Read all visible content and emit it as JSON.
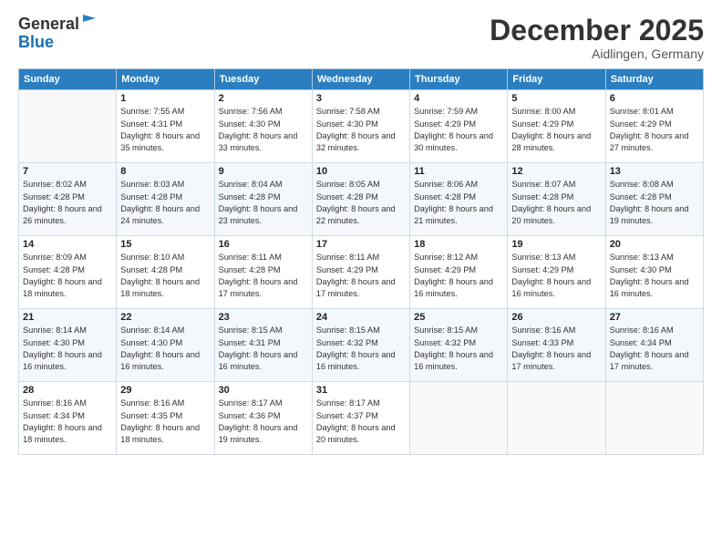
{
  "header": {
    "logo_line1": "General",
    "logo_line2": "Blue",
    "month": "December 2025",
    "location": "Aidlingen, Germany"
  },
  "weekdays": [
    "Sunday",
    "Monday",
    "Tuesday",
    "Wednesday",
    "Thursday",
    "Friday",
    "Saturday"
  ],
  "weeks": [
    [
      {
        "day": "",
        "sunrise": "",
        "sunset": "",
        "daylight": ""
      },
      {
        "day": "1",
        "sunrise": "Sunrise: 7:55 AM",
        "sunset": "Sunset: 4:31 PM",
        "daylight": "Daylight: 8 hours and 35 minutes."
      },
      {
        "day": "2",
        "sunrise": "Sunrise: 7:56 AM",
        "sunset": "Sunset: 4:30 PM",
        "daylight": "Daylight: 8 hours and 33 minutes."
      },
      {
        "day": "3",
        "sunrise": "Sunrise: 7:58 AM",
        "sunset": "Sunset: 4:30 PM",
        "daylight": "Daylight: 8 hours and 32 minutes."
      },
      {
        "day": "4",
        "sunrise": "Sunrise: 7:59 AM",
        "sunset": "Sunset: 4:29 PM",
        "daylight": "Daylight: 8 hours and 30 minutes."
      },
      {
        "day": "5",
        "sunrise": "Sunrise: 8:00 AM",
        "sunset": "Sunset: 4:29 PM",
        "daylight": "Daylight: 8 hours and 28 minutes."
      },
      {
        "day": "6",
        "sunrise": "Sunrise: 8:01 AM",
        "sunset": "Sunset: 4:29 PM",
        "daylight": "Daylight: 8 hours and 27 minutes."
      }
    ],
    [
      {
        "day": "7",
        "sunrise": "Sunrise: 8:02 AM",
        "sunset": "Sunset: 4:28 PM",
        "daylight": "Daylight: 8 hours and 26 minutes."
      },
      {
        "day": "8",
        "sunrise": "Sunrise: 8:03 AM",
        "sunset": "Sunset: 4:28 PM",
        "daylight": "Daylight: 8 hours and 24 minutes."
      },
      {
        "day": "9",
        "sunrise": "Sunrise: 8:04 AM",
        "sunset": "Sunset: 4:28 PM",
        "daylight": "Daylight: 8 hours and 23 minutes."
      },
      {
        "day": "10",
        "sunrise": "Sunrise: 8:05 AM",
        "sunset": "Sunset: 4:28 PM",
        "daylight": "Daylight: 8 hours and 22 minutes."
      },
      {
        "day": "11",
        "sunrise": "Sunrise: 8:06 AM",
        "sunset": "Sunset: 4:28 PM",
        "daylight": "Daylight: 8 hours and 21 minutes."
      },
      {
        "day": "12",
        "sunrise": "Sunrise: 8:07 AM",
        "sunset": "Sunset: 4:28 PM",
        "daylight": "Daylight: 8 hours and 20 minutes."
      },
      {
        "day": "13",
        "sunrise": "Sunrise: 8:08 AM",
        "sunset": "Sunset: 4:28 PM",
        "daylight": "Daylight: 8 hours and 19 minutes."
      }
    ],
    [
      {
        "day": "14",
        "sunrise": "Sunrise: 8:09 AM",
        "sunset": "Sunset: 4:28 PM",
        "daylight": "Daylight: 8 hours and 18 minutes."
      },
      {
        "day": "15",
        "sunrise": "Sunrise: 8:10 AM",
        "sunset": "Sunset: 4:28 PM",
        "daylight": "Daylight: 8 hours and 18 minutes."
      },
      {
        "day": "16",
        "sunrise": "Sunrise: 8:11 AM",
        "sunset": "Sunset: 4:28 PM",
        "daylight": "Daylight: 8 hours and 17 minutes."
      },
      {
        "day": "17",
        "sunrise": "Sunrise: 8:11 AM",
        "sunset": "Sunset: 4:29 PM",
        "daylight": "Daylight: 8 hours and 17 minutes."
      },
      {
        "day": "18",
        "sunrise": "Sunrise: 8:12 AM",
        "sunset": "Sunset: 4:29 PM",
        "daylight": "Daylight: 8 hours and 16 minutes."
      },
      {
        "day": "19",
        "sunrise": "Sunrise: 8:13 AM",
        "sunset": "Sunset: 4:29 PM",
        "daylight": "Daylight: 8 hours and 16 minutes."
      },
      {
        "day": "20",
        "sunrise": "Sunrise: 8:13 AM",
        "sunset": "Sunset: 4:30 PM",
        "daylight": "Daylight: 8 hours and 16 minutes."
      }
    ],
    [
      {
        "day": "21",
        "sunrise": "Sunrise: 8:14 AM",
        "sunset": "Sunset: 4:30 PM",
        "daylight": "Daylight: 8 hours and 16 minutes."
      },
      {
        "day": "22",
        "sunrise": "Sunrise: 8:14 AM",
        "sunset": "Sunset: 4:30 PM",
        "daylight": "Daylight: 8 hours and 16 minutes."
      },
      {
        "day": "23",
        "sunrise": "Sunrise: 8:15 AM",
        "sunset": "Sunset: 4:31 PM",
        "daylight": "Daylight: 8 hours and 16 minutes."
      },
      {
        "day": "24",
        "sunrise": "Sunrise: 8:15 AM",
        "sunset": "Sunset: 4:32 PM",
        "daylight": "Daylight: 8 hours and 16 minutes."
      },
      {
        "day": "25",
        "sunrise": "Sunrise: 8:15 AM",
        "sunset": "Sunset: 4:32 PM",
        "daylight": "Daylight: 8 hours and 16 minutes."
      },
      {
        "day": "26",
        "sunrise": "Sunrise: 8:16 AM",
        "sunset": "Sunset: 4:33 PM",
        "daylight": "Daylight: 8 hours and 17 minutes."
      },
      {
        "day": "27",
        "sunrise": "Sunrise: 8:16 AM",
        "sunset": "Sunset: 4:34 PM",
        "daylight": "Daylight: 8 hours and 17 minutes."
      }
    ],
    [
      {
        "day": "28",
        "sunrise": "Sunrise: 8:16 AM",
        "sunset": "Sunset: 4:34 PM",
        "daylight": "Daylight: 8 hours and 18 minutes."
      },
      {
        "day": "29",
        "sunrise": "Sunrise: 8:16 AM",
        "sunset": "Sunset: 4:35 PM",
        "daylight": "Daylight: 8 hours and 18 minutes."
      },
      {
        "day": "30",
        "sunrise": "Sunrise: 8:17 AM",
        "sunset": "Sunset: 4:36 PM",
        "daylight": "Daylight: 8 hours and 19 minutes."
      },
      {
        "day": "31",
        "sunrise": "Sunrise: 8:17 AM",
        "sunset": "Sunset: 4:37 PM",
        "daylight": "Daylight: 8 hours and 20 minutes."
      },
      {
        "day": "",
        "sunrise": "",
        "sunset": "",
        "daylight": ""
      },
      {
        "day": "",
        "sunrise": "",
        "sunset": "",
        "daylight": ""
      },
      {
        "day": "",
        "sunrise": "",
        "sunset": "",
        "daylight": ""
      }
    ]
  ]
}
